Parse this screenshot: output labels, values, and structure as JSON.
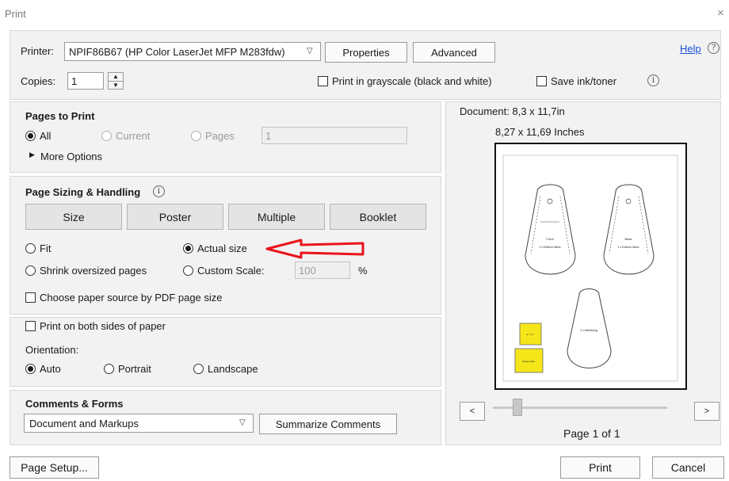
{
  "window": {
    "title": "Print",
    "close_glyph": "×"
  },
  "printer": {
    "label": "Printer:",
    "value": "NPIF86B67 (HP Color LaserJet MFP M283fdw)",
    "properties_label": "Properties",
    "advanced_label": "Advanced",
    "help_label": "Help"
  },
  "copies": {
    "label": "Copies:",
    "value": "1"
  },
  "options": {
    "grayscale_label": "Print in grayscale (black and white)",
    "grayscale_checked": false,
    "save_ink_label": "Save ink/toner",
    "save_ink_checked": false
  },
  "pages_to_print": {
    "title": "Pages to Print",
    "all_label": "All",
    "current_label": "Current",
    "pages_label": "Pages",
    "pages_value": "1",
    "selected": "All",
    "more_options_label": "More Options"
  },
  "sizing": {
    "title": "Page Sizing & Handling",
    "tabs": [
      "Size",
      "Poster",
      "Multiple",
      "Booklet"
    ],
    "fit_label": "Fit",
    "actual_size_label": "Actual size",
    "shrink_label": "Shrink oversized pages",
    "custom_scale_label": "Custom Scale:",
    "custom_scale_value": "100",
    "percent_label": "%",
    "selected": "Actual size",
    "choose_paper_label": "Choose paper source by PDF page size"
  },
  "duplex": {
    "both_sides_label": "Print on both sides of paper",
    "orientation_label": "Orientation:",
    "auto_label": "Auto",
    "portrait_label": "Portrait",
    "landscape_label": "Landscape",
    "selected": "Auto"
  },
  "comments": {
    "title": "Comments & Forms",
    "select_value": "Document and Markups",
    "summarize_label": "Summarize Comments"
  },
  "preview": {
    "document_label": "Document: 8,3 x 11,7in",
    "size_label": "8,27 x 11,69 Inches",
    "page_label": "Page 1 of 1",
    "prev_glyph": "<",
    "next_glyph": ">",
    "tag_left": {
      "title": "Front",
      "sub": "1 x Exterior fabric"
    },
    "tag_right": {
      "title": "Back",
      "sub": "1 x Exterior fabric"
    },
    "tag_bottom": {
      "title": "2 x interfacing"
    },
    "yellow_small": "2\" x 2\"",
    "yellow_large": "Scales Safe"
  },
  "footer": {
    "page_setup_label": "Page Setup...",
    "print_label": "Print",
    "cancel_label": "Cancel"
  },
  "colors": {
    "annotation_arrow": "#e8141c",
    "label_highlight": "#f5e61a"
  }
}
